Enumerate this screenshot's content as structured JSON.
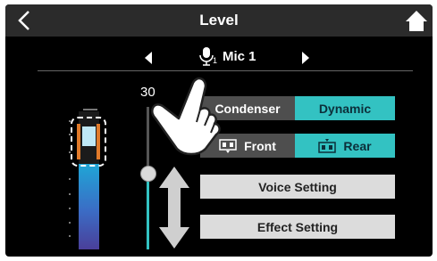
{
  "header": {
    "title": "Level",
    "back_icon": "chevron-left-icon",
    "home_icon": "home-icon"
  },
  "channel": {
    "name": "Mic 1",
    "number": "1",
    "prev_icon": "triangle-left-icon",
    "next_icon": "triangle-right-icon",
    "mic_icon": "microphone-icon"
  },
  "level": {
    "value": "30",
    "slider_fraction": 0.53
  },
  "meter": {
    "fill_fraction": 0.62
  },
  "mic_type": {
    "condenser_label": "Condenser",
    "dynamic_label": "Dynamic",
    "selected": "Dynamic"
  },
  "mic_direction": {
    "front_label": "Front",
    "rear_label": "Rear",
    "selected": "Rear"
  },
  "buttons": {
    "voice_setting_label": "Voice Setting",
    "effect_setting_label": "Effect Setting"
  },
  "colors": {
    "accent": "#33c2c2",
    "background": "#000000",
    "header": "#2b2b2b",
    "peak": "#e07a2a"
  }
}
